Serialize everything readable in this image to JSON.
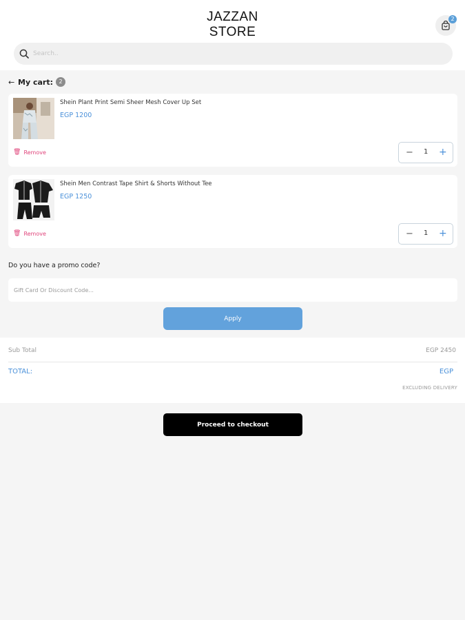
{
  "header": {
    "logo_line1": "JAZZAN",
    "logo_line2": "STORE",
    "cart_count": "2"
  },
  "search": {
    "placeholder": "Search..",
    "value": ""
  },
  "cart": {
    "title": "My cart",
    "count": "2",
    "items": [
      {
        "name": "Shein Plant Print Semi Sheer Mesh Cover Up Set",
        "price": "EGP 1200",
        "quantity": "1",
        "remove_label": "Remove"
      },
      {
        "name": "Shein Men Contrast Tape Shirt & Shorts Without Tee",
        "price": "EGP 1250",
        "quantity": "1",
        "remove_label": "Remove"
      }
    ]
  },
  "promo": {
    "question": "Do you have a promo code?",
    "placeholder": "Gift Card Or Discount Code...",
    "apply_label": "Apply"
  },
  "summary": {
    "subtotal_label": "Sub Total",
    "subtotal_value": "EGP 2450",
    "total_label": "TOTAL:",
    "total_value": "EGP",
    "note": "EXCLUDING DELIVERY"
  },
  "checkout": {
    "label": "Proceed to checkout"
  },
  "colors": {
    "accent": "#4a90d9",
    "apply_button": "#62a2dc",
    "remove": "#e0457b",
    "checkout_button": "#000000"
  }
}
